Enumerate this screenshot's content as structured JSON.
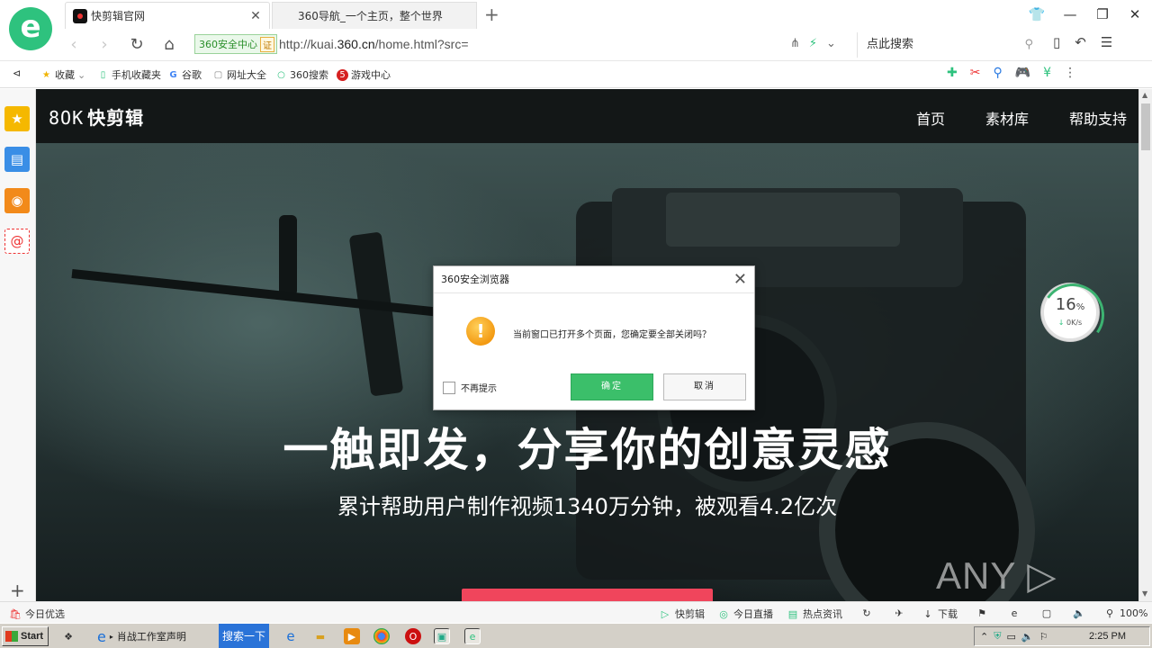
{
  "browser": {
    "tabs": [
      {
        "title": "快剪辑官网",
        "active": true
      },
      {
        "title": "360导航_一个主页，整个世界",
        "active": false
      }
    ],
    "security_badge": "360安全中心",
    "security_cert": "证",
    "url_prefix": "http://kuai.",
    "url_domain": "360.cn",
    "url_suffix": "/home.html?src=",
    "search_placeholder": "点此搜索",
    "bookmarks": [
      {
        "label": "收藏",
        "icon": "star-icon"
      },
      {
        "label": "手机收藏夹",
        "icon": "phone-icon"
      },
      {
        "label": "谷歌",
        "icon": "google-icon"
      },
      {
        "label": "网址大全",
        "icon": "page-icon"
      },
      {
        "label": "360搜索",
        "icon": "search360-icon"
      },
      {
        "label": "游戏中心",
        "icon": "game-icon"
      }
    ]
  },
  "site": {
    "logo_mark": "8OK",
    "logo_text": "快剪辑",
    "nav": [
      "首页",
      "素材库",
      "帮助支持"
    ],
    "headline": "一触即发，分享你的创意灵感",
    "subline": "累计帮助用户制作视频1340万分钟，被观看4.2亿次"
  },
  "speed_widget": {
    "percent": "16",
    "unit": "%",
    "rate": "0K/s"
  },
  "watermark": "ANY ▷ RUN",
  "dialog": {
    "title": "360安全浏览器",
    "message": "当前窗口已打开多个页面，您确定要全部关闭吗？",
    "checkbox_label": "不再提示",
    "ok_label": "确定",
    "cancel_label": "取消"
  },
  "statusbar": {
    "left_label": "今日优选",
    "items": [
      "快剪辑",
      "今日直播",
      "热点资讯",
      "下载"
    ],
    "zoom": "100%"
  },
  "taskbar": {
    "start_label": "Start",
    "task_label": "肖战工作室声明",
    "search_label": "搜索一下",
    "clock": "2:25 PM"
  }
}
